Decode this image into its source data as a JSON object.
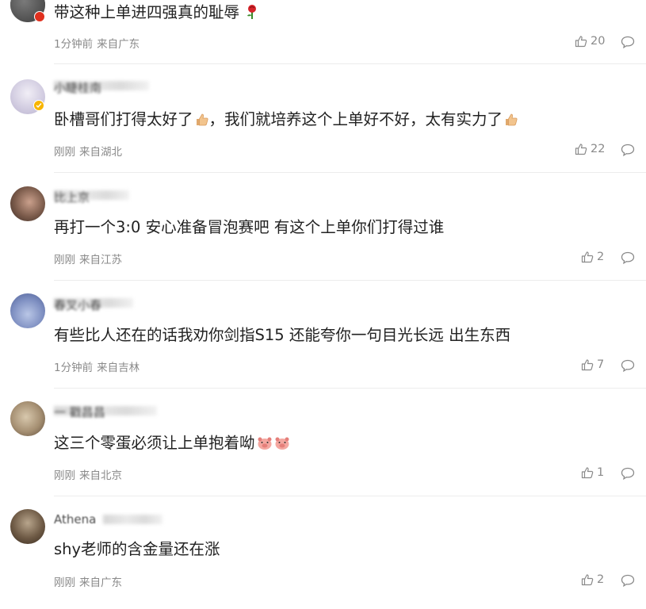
{
  "comments": [
    {
      "username": "",
      "text": "带这种上单进四强真的耻辱",
      "text_emoji": "rose-emoji",
      "time": "1分钟前",
      "location": "来自广东",
      "likes": "20",
      "badge": "red",
      "avatar_color": "#6b6b6b"
    },
    {
      "username": "小睫桂南",
      "text": "卧槽哥们打得太好了",
      "text_emoji": "thumbs-up-emoji",
      "text_after": "，我们就培养这个上单好不好，太有实力了",
      "text_after_emoji": "thumbs-up-emoji",
      "time": "刚刚",
      "location": "来自湖北",
      "likes": "22",
      "badge": "gold",
      "avatar_color": "#d8d4e6"
    },
    {
      "username": "比上京",
      "text": "再打一个3:0 安心准备冒泡赛吧 有这个上单你们打得过谁",
      "time": "刚刚",
      "location": "来自江苏",
      "likes": "2",
      "avatar_color": "#8a6a5a"
    },
    {
      "username": "春叉小春",
      "text": "有些比人还在的话我劝你剑指S15 还能夸你一句目光长远 出生东西",
      "time": "1分钟前",
      "location": "来自吉林",
      "likes": "7",
      "avatar_color": "#8fa0c8"
    },
    {
      "username": "一 戳昌昌",
      "text": "这三个零蛋必须让上单抱着呦",
      "text_emoji": "pig-emoji",
      "time": "刚刚",
      "location": "来自北京",
      "likes": "1",
      "avatar_color": "#a8957a"
    },
    {
      "username": "Athena",
      "text": "shy老师的含金量还在涨",
      "time": "刚刚",
      "location": "来自广东",
      "likes": "2",
      "avatar_color": "#6e5a45"
    }
  ]
}
